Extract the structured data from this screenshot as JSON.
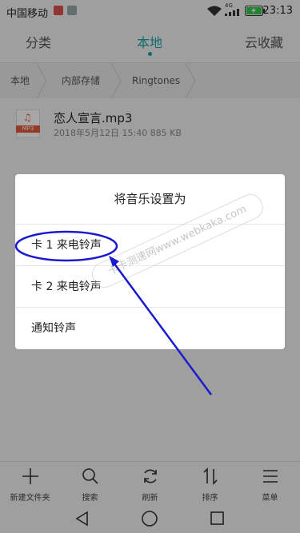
{
  "status_bar": {
    "carrier": "中国移动",
    "network": "4G",
    "time": "23:13"
  },
  "tabs": [
    {
      "label": "分类",
      "active": false
    },
    {
      "label": "本地",
      "active": true
    },
    {
      "label": "云收藏",
      "active": false
    }
  ],
  "breadcrumb": [
    "本地",
    "内部存储",
    "Ringtones"
  ],
  "file": {
    "name": "恋人宣言.mp3",
    "meta": "2018年5月12日 15:40 885 KB",
    "badge": "MP3"
  },
  "dialog": {
    "title": "将音乐设置为",
    "options": [
      "卡 1 来电铃声",
      "卡 2 来电铃声",
      "通知铃声"
    ]
  },
  "toolbar": [
    {
      "label": "新建文件夹",
      "icon": "plus-icon"
    },
    {
      "label": "搜索",
      "icon": "search-icon"
    },
    {
      "label": "刷新",
      "icon": "refresh-icon"
    },
    {
      "label": "排序",
      "icon": "sort-icon"
    },
    {
      "label": "菜单",
      "icon": "menu-icon"
    }
  ],
  "watermark": "卡卡测速网www.webkaka.com",
  "colors": {
    "accent": "#1aa1a8",
    "annotation": "#1a1ad0",
    "mp3_badge": "#e45a3b"
  }
}
